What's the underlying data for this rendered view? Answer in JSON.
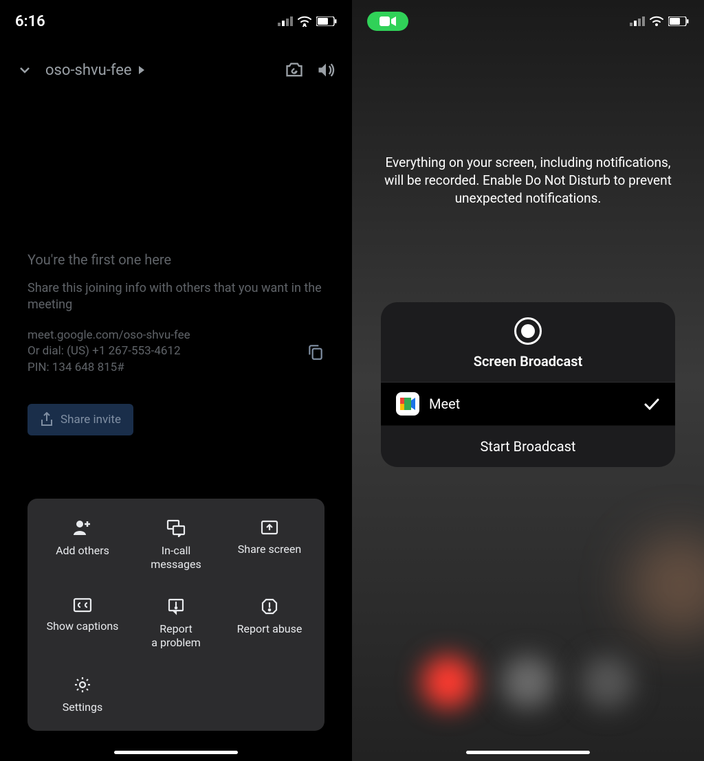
{
  "left": {
    "status_time": "6:16",
    "meeting_code": "oso-shvu-fee",
    "first_here": "You're the first one here",
    "share_desc": "Share this joining info with others that you want in the meeting",
    "join_url": "meet.google.com/oso-shvu-fee",
    "join_dial": "Or dial: (US) +1 267-553-4612",
    "join_pin": "PIN: 134 648 815#",
    "share_invite": "Share invite",
    "sheet": {
      "add_others": "Add others",
      "in_call_messages": "In-call\nmessages",
      "share_screen": "Share screen",
      "show_captions": "Show captions",
      "report_problem": "Report\na problem",
      "report_abuse": "Report abuse",
      "settings": "Settings"
    }
  },
  "right": {
    "warning": "Everything on your screen, including notifications, will be recorded. Enable Do Not Disturb to prevent unexpected notifications.",
    "broadcast_title": "Screen Broadcast",
    "app_name": "Meet",
    "start": "Start Broadcast"
  }
}
